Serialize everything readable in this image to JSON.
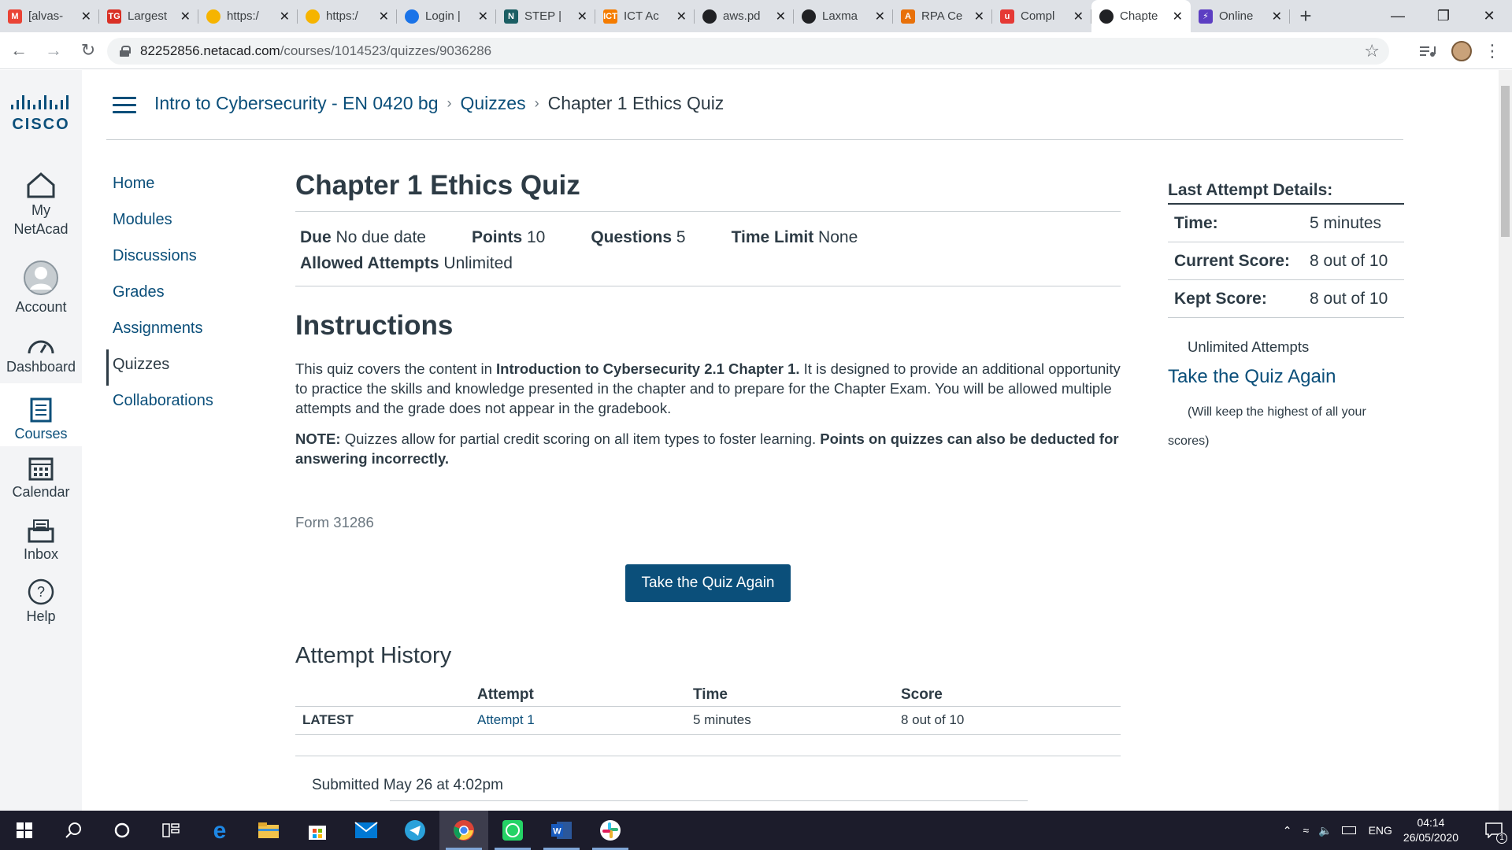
{
  "browser": {
    "tabs": [
      {
        "title": "[alvas-",
        "icon": "gmail-icon",
        "color": "#ea4335",
        "glyph": "M"
      },
      {
        "title": "Largest",
        "icon": "tg-icon",
        "color": "#d93025",
        "glyph": "TG"
      },
      {
        "title": "https:/",
        "icon": "folder-icon",
        "color": "#f6b400",
        "glyph": ""
      },
      {
        "title": "https:/",
        "icon": "folder-icon",
        "color": "#f6b400",
        "glyph": ""
      },
      {
        "title": "Login |",
        "icon": "cloud-icon",
        "color": "#1a73e8",
        "glyph": ""
      },
      {
        "title": "STEP |",
        "icon": "step-icon",
        "color": "#1b5e63",
        "glyph": "N"
      },
      {
        "title": "ICT Ac",
        "icon": "ict-icon",
        "color": "#f57c00",
        "glyph": "ICT"
      },
      {
        "title": "aws.pd",
        "icon": "globe-icon",
        "color": "#202124",
        "glyph": ""
      },
      {
        "title": "Laxma",
        "icon": "github-icon",
        "color": "#202124",
        "glyph": ""
      },
      {
        "title": "RPA Ce",
        "icon": "rpa-icon",
        "color": "#e8710a",
        "glyph": "A"
      },
      {
        "title": "Compl",
        "icon": "u-icon",
        "color": "#e53935",
        "glyph": "u"
      },
      {
        "title": "Chapte",
        "icon": "globe-icon",
        "color": "#202124",
        "glyph": "",
        "active": true
      },
      {
        "title": "Online",
        "icon": "bolt-icon",
        "color": "#5c3ec2",
        "glyph": "⚡"
      }
    ],
    "url_host": "82252856.netacad.com",
    "url_path": "/courses/1014523/quizzes/9036286"
  },
  "global_nav": [
    {
      "label1": "My",
      "label2": "NetAcad",
      "icon": "home-icon"
    },
    {
      "label1": "Account",
      "label2": "",
      "icon": "account-icon"
    },
    {
      "label1": "Dashboard",
      "label2": "",
      "icon": "dashboard-icon"
    },
    {
      "label1": "Courses",
      "label2": "",
      "icon": "courses-icon",
      "active": true
    },
    {
      "label1": "Calendar",
      "label2": "",
      "icon": "calendar-icon"
    },
    {
      "label1": "Inbox",
      "label2": "",
      "icon": "inbox-icon"
    },
    {
      "label1": "Help",
      "label2": "",
      "icon": "help-icon"
    }
  ],
  "logo_text": "CISCO",
  "breadcrumb": {
    "course": "Intro to Cybersecurity - EN 0420 bg",
    "section": "Quizzes",
    "current": "Chapter 1 Ethics Quiz",
    "sep": "›"
  },
  "course_nav": [
    "Home",
    "Modules",
    "Discussions",
    "Grades",
    "Assignments",
    "Quizzes",
    "Collaborations"
  ],
  "course_nav_active": "Quizzes",
  "quiz": {
    "title": "Chapter 1 Ethics Quiz",
    "due_label": "Due",
    "due_value": "No due date",
    "points_label": "Points",
    "points_value": "10",
    "questions_label": "Questions",
    "questions_value": "5",
    "time_limit_label": "Time Limit",
    "time_limit_value": "None",
    "attempts_label": "Allowed Attempts",
    "attempts_value": "Unlimited"
  },
  "instructions": {
    "heading": "Instructions",
    "p1_a": "This quiz covers the content in ",
    "p1_b": "Introduction to Cybersecurity 2.1 Chapter 1.",
    "p1_c": " It is designed to provide an additional opportunity to practice the skills and knowledge presented in the chapter and to prepare for the Chapter Exam. You will be allowed multiple attempts and the grade does not appear in the gradebook.",
    "p2_a": "NOTE:",
    "p2_b": " Quizzes allow for partial credit scoring on all item types to foster learning. ",
    "p2_c": "Points on quizzes can also be deducted for answering incorrectly."
  },
  "form_id": "Form 31286",
  "take_again_button": "Take the Quiz Again",
  "attempt_history": {
    "heading": "Attempt History",
    "columns": [
      "",
      "Attempt",
      "Time",
      "Score"
    ],
    "rows": [
      {
        "label": "LATEST",
        "attempt": "Attempt 1",
        "time": "5 minutes",
        "score": "8 out of 10"
      }
    ],
    "submitted": "Submitted May 26 at 4:02pm"
  },
  "sidebar": {
    "heading": "Last Attempt Details:",
    "time_label": "Time:",
    "time_value": "5 minutes",
    "current_label": "Current Score:",
    "current_value": "8 out of 10",
    "kept_label": "Kept Score:",
    "kept_value": "8 out of 10",
    "attempts_note": "Unlimited Attempts",
    "take_again_link": "Take the Quiz Again",
    "keep_note": "(Will keep the highest of all your scores)"
  },
  "taskbar": {
    "language": "ENG",
    "time": "04:14",
    "date": "26/05/2020",
    "notification_count": "1"
  }
}
